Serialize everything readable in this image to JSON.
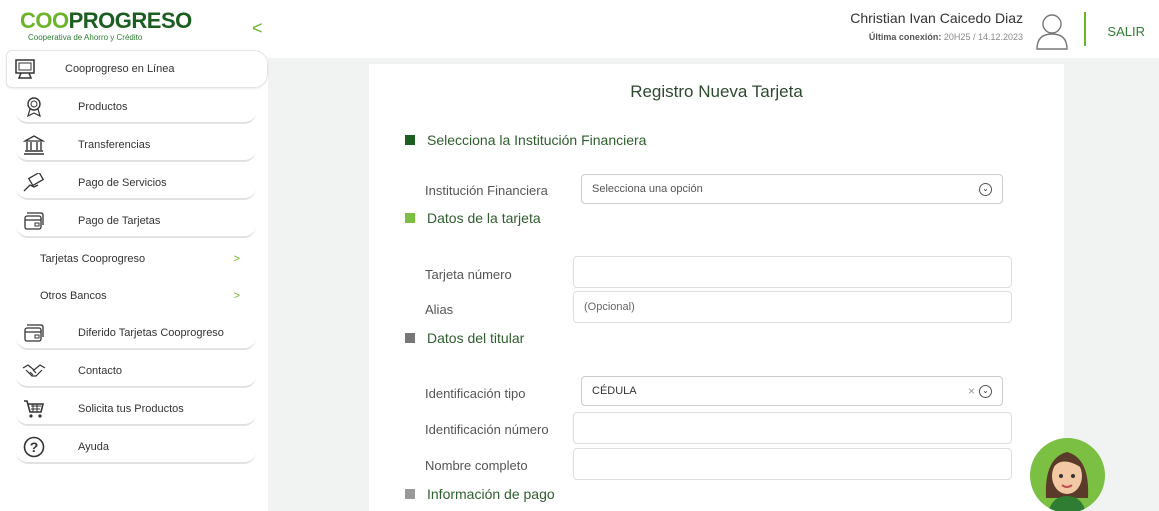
{
  "brand": {
    "name_part1": "COO",
    "name_part2": "PROGRESO",
    "subtitle": "Cooperativa de Ahorro y Crédito"
  },
  "sidebar": {
    "top_item": {
      "label": "Cooprogreso en Línea",
      "icon": "computer-icon"
    },
    "items": [
      {
        "label": "Productos",
        "icon": "award-icon"
      },
      {
        "label": "Transferencias",
        "icon": "bank-icon"
      },
      {
        "label": "Pago de Servicios",
        "icon": "hand-money-icon"
      },
      {
        "label": "Pago de Tarjetas",
        "icon": "credit-card-icon"
      },
      {
        "label": "Diferido Tarjetas Cooprogreso",
        "icon": "credit-card-icon"
      },
      {
        "label": "Contacto",
        "icon": "handshake-icon"
      },
      {
        "label": "Solicita tus Productos",
        "icon": "cart-icon"
      },
      {
        "label": "Ayuda",
        "icon": "question-icon"
      }
    ],
    "sub_items": [
      {
        "label": "Tarjetas Cooprogreso",
        "chevron": ">"
      },
      {
        "label": "Otros Bancos",
        "chevron": ">"
      }
    ],
    "collapse_glyph": "<"
  },
  "header": {
    "user_name": "Christian Ivan Caicedo Diaz",
    "last_conn_label": "Última conexión:",
    "last_conn_value": "20H25 / 14.12.2023",
    "logout": "SALIR"
  },
  "form": {
    "title": "Registro Nueva Tarjeta",
    "sections": {
      "institution": "Selecciona la Institución Financiera",
      "card": "Datos de la tarjeta",
      "holder": "Datos del titular",
      "payment": "Información de pago"
    },
    "institution_label": "Institución Financiera",
    "institution_placeholder": "Selecciona una opción",
    "card_number_label": "Tarjeta número",
    "alias_label": "Alias",
    "alias_placeholder": "(Opcional)",
    "id_type_label": "Identificación tipo",
    "id_type_value": "CÉDULA",
    "id_number_label": "Identificación número",
    "full_name_label": "Nombre completo"
  },
  "colors": {
    "dark_green": "#1b5e20",
    "light_green": "#6cb42c",
    "gray_square": "#777777"
  }
}
